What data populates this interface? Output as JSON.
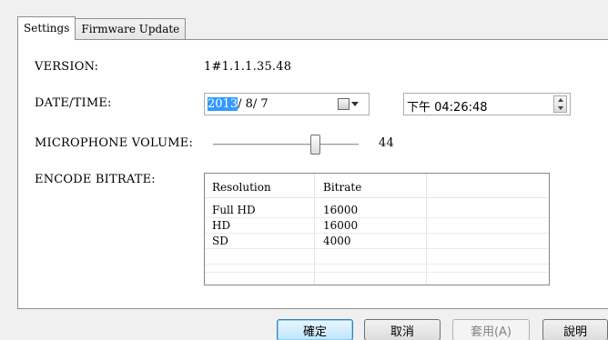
{
  "tabs": [
    {
      "label": "Settings",
      "active": true
    },
    {
      "label": "Firmware Update",
      "active": false
    }
  ],
  "version": {
    "label": "VERSION:",
    "value": "1#1.1.1.35.48"
  },
  "datetime": {
    "label": "DATE/TIME:",
    "date_year": "2013",
    "date_rest": "/ 8/ 7",
    "time": "下午 04:26:48"
  },
  "microphone": {
    "label": "MICROPHONE VOLUME:",
    "value": "44",
    "level_percent": 70
  },
  "encode": {
    "label": "ENCODE BITRATE:",
    "columns": [
      "Resolution",
      "Bitrate"
    ],
    "rows": [
      [
        "Full HD",
        "16000"
      ],
      [
        "HD",
        "16000"
      ],
      [
        "SD",
        "4000"
      ]
    ]
  },
  "buttons": {
    "ok": "確定",
    "cancel": "取消",
    "apply": "套用(A)",
    "help": "說明"
  },
  "colors": {
    "selection": "#3399ff",
    "default_button": "#bee6fd"
  },
  "icons": {
    "calendar": "calendar-icon",
    "dropdown": "chevron-down-icon",
    "spin": "spin-updown-icon"
  }
}
